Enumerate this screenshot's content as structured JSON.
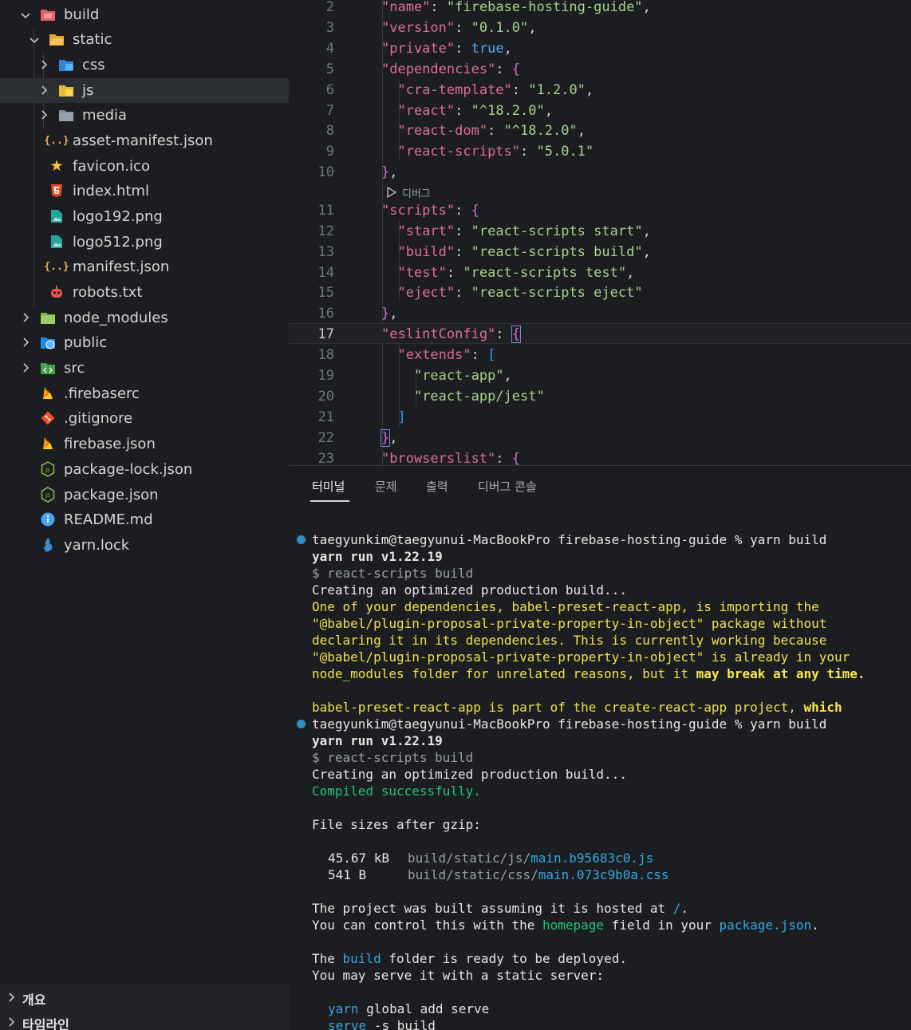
{
  "explorer": {
    "items": [
      {
        "label": "build",
        "icon": "folder-build-icon",
        "expanded": true
      },
      {
        "label": "static",
        "icon": "folder-static-icon",
        "expanded": true
      },
      {
        "label": "css",
        "icon": "folder-css-icon",
        "expanded": false
      },
      {
        "label": "js",
        "icon": "folder-js-icon",
        "expanded": false,
        "selected": true
      },
      {
        "label": "media",
        "icon": "folder-media-icon",
        "expanded": false
      },
      {
        "label": "asset-manifest.json",
        "icon": "json-file-icon"
      },
      {
        "label": "favicon.ico",
        "icon": "favicon-star-icon"
      },
      {
        "label": "index.html",
        "icon": "html5-icon"
      },
      {
        "label": "logo192.png",
        "icon": "image-file-icon"
      },
      {
        "label": "logo512.png",
        "icon": "image-file-icon"
      },
      {
        "label": "manifest.json",
        "icon": "json-file-icon"
      },
      {
        "label": "robots.txt",
        "icon": "robot-icon"
      },
      {
        "label": "node_modules",
        "icon": "folder-node-icon",
        "expanded": false
      },
      {
        "label": "public",
        "icon": "folder-public-icon",
        "expanded": false
      },
      {
        "label": "src",
        "icon": "folder-src-icon",
        "expanded": false
      },
      {
        "label": ".firebaserc",
        "icon": "firebase-icon"
      },
      {
        "label": ".gitignore",
        "icon": "git-icon"
      },
      {
        "label": "firebase.json",
        "icon": "firebase-icon"
      },
      {
        "label": "package-lock.json",
        "icon": "nodejs-icon"
      },
      {
        "label": "package.json",
        "icon": "nodejs-icon"
      },
      {
        "label": "README.md",
        "icon": "info-icon"
      },
      {
        "label": "yarn.lock",
        "icon": "yarn-icon"
      }
    ],
    "panels": [
      {
        "label": "개요"
      },
      {
        "label": "타임라인"
      }
    ]
  },
  "editor": {
    "line_numbers": [
      "2",
      "3",
      "4",
      "5",
      "6",
      "7",
      "8",
      "9",
      "10",
      "11",
      "12",
      "13",
      "14",
      "15",
      "16",
      "17",
      "18",
      "19",
      "20",
      "21",
      "22",
      "23"
    ],
    "current_line": "17",
    "codelens": "디버그",
    "code": {
      "name_key": "\"name\"",
      "name_val": "\"firebase-hosting-guide\"",
      "version_key": "\"version\"",
      "version_val": "\"0.1.0\"",
      "private_key": "\"private\"",
      "private_val": "true",
      "deps_key": "\"dependencies\"",
      "cra_key": "\"cra-template\"",
      "cra_val": "\"1.2.0\"",
      "react_key": "\"react\"",
      "react_val": "\"^18.2.0\"",
      "reactdom_key": "\"react-dom\"",
      "reactdom_val": "\"^18.2.0\"",
      "rs_key": "\"react-scripts\"",
      "rs_val": "\"5.0.1\"",
      "scripts_key": "\"scripts\"",
      "start_key": "\"start\"",
      "start_val": "\"react-scripts start\"",
      "build_key": "\"build\"",
      "build_val": "\"react-scripts build\"",
      "test_key": "\"test\"",
      "test_val": "\"react-scripts test\"",
      "eject_key": "\"eject\"",
      "eject_val": "\"react-scripts eject\"",
      "eslint_key": "\"eslintConfig\"",
      "extends_key": "\"extends\"",
      "ext_val1": "\"react-app\"",
      "ext_val2": "\"react-app/jest\"",
      "browsers_key": "\"browserslist\""
    }
  },
  "terminal": {
    "tabs": [
      {
        "label": "터미널",
        "active": true
      },
      {
        "label": "문제"
      },
      {
        "label": "출력"
      },
      {
        "label": "디버그 콘솔"
      }
    ],
    "prompt": "taegyunkim@taegyunui-MacBookPro firebase-hosting-guide % yarn build",
    "yarn_version": "yarn run v1.22.19",
    "cmd": "$ react-scripts build",
    "creating": "Creating an optimized production build...",
    "warning": [
      "One of your dependencies, babel-preset-react-app, is importing the",
      "\"@babel/plugin-proposal-private-property-in-object\" package without",
      "declaring it in its dependencies. This is currently working because",
      "\"@babel/plugin-proposal-private-property-in-object\" is already in your",
      "node_modules folder for unrelated reasons, but it ",
      "may break at any time."
    ],
    "warning2_a": "babel-preset-react-app is part of the create-react-app project, ",
    "warning2_b": "which",
    "compiled": "Compiled successfully.",
    "file_sizes": "File sizes after gzip:",
    "files": [
      {
        "size": "45.67 kB",
        "dir": "build/static/js/",
        "name": "main.b95683c0.js"
      },
      {
        "size": "541 B",
        "dir": "build/static/css/",
        "name": "main.073c9b0a.css"
      }
    ],
    "hosted_a": "The project was built assuming it is hosted at ",
    "hosted_path": "/",
    "hosted_b": ".",
    "control_a": "You can control this with the ",
    "control_homepage": "homepage",
    "control_b": " field in your ",
    "control_pkg": "package.json",
    "control_c": ".",
    "ready_a": "The ",
    "ready_build": "build",
    "ready_b": " folder is ready to be deployed.",
    "serve_line": "You may serve it with a static server:",
    "cmd1_a": "yarn",
    "cmd1_b": " global add serve",
    "cmd2_a": "serve",
    "cmd2_b": " -s build"
  }
}
